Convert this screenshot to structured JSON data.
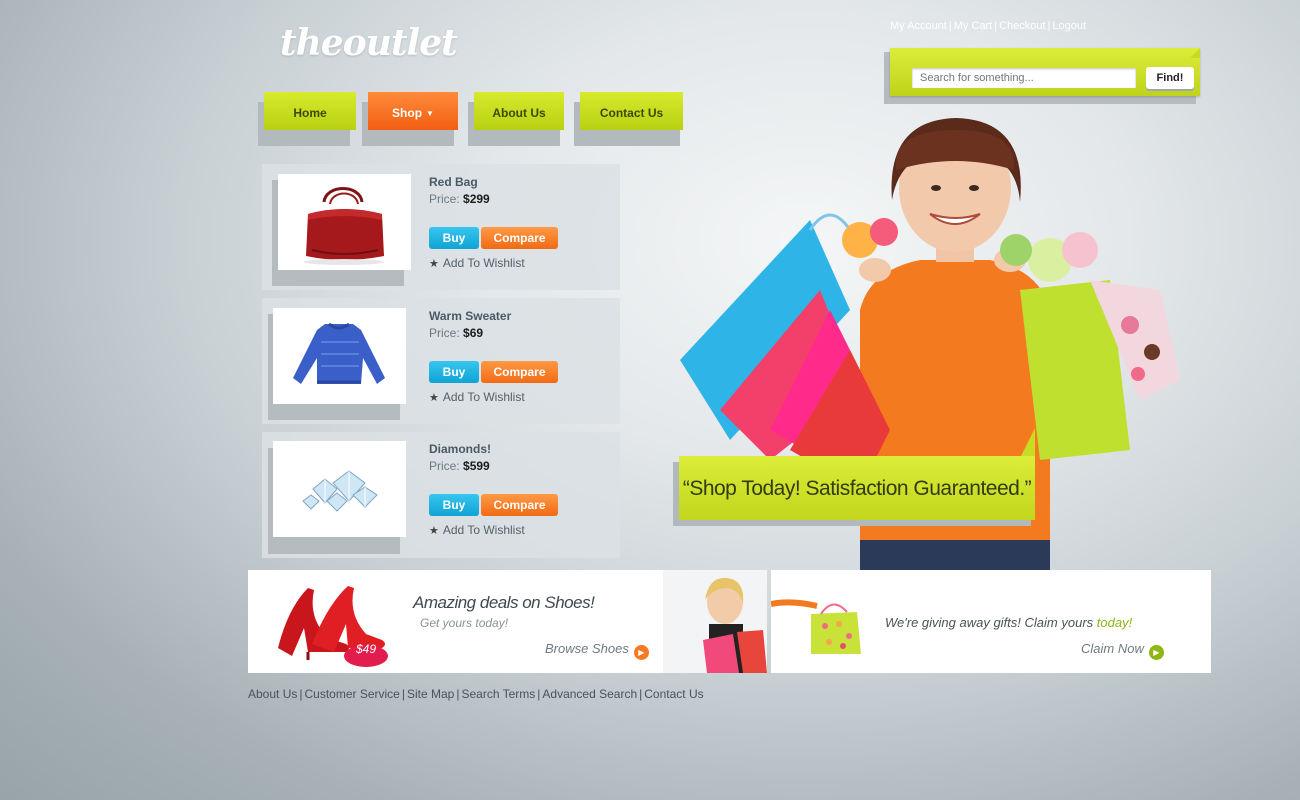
{
  "logo": "theoutlet",
  "top_links": [
    "My Account",
    "My Cart",
    "Checkout",
    "Logout"
  ],
  "search": {
    "placeholder": "Search for something...",
    "button": "Find!"
  },
  "nav": [
    {
      "label": "Home"
    },
    {
      "label": "Shop",
      "active": true
    },
    {
      "label": "About Us"
    },
    {
      "label": "Contact Us"
    }
  ],
  "products": [
    {
      "name": "Red Bag",
      "price_label": "Price:",
      "price": "$299",
      "buy": "Buy",
      "compare": "Compare",
      "wishlist": "Add To Wishlist"
    },
    {
      "name": "Warm Sweater",
      "price_label": "Price:",
      "price": "$69",
      "buy": "Buy",
      "compare": "Compare",
      "wishlist": "Add To Wishlist"
    },
    {
      "name": "Diamonds!",
      "price_label": "Price:",
      "price": "$599",
      "buy": "Buy",
      "compare": "Compare",
      "wishlist": "Add To Wishlist"
    }
  ],
  "hero": {
    "tagline": "“Shop Today! Satisfaction Guaranteed.”"
  },
  "promos": {
    "shoes": {
      "title": "Amazing deals on Shoes!",
      "subtitle": "Get yours today!",
      "link": "Browse Shoes",
      "price_tag": "$49"
    },
    "gifts": {
      "text": "We're giving away gifts! Claim yours",
      "highlight": "today!",
      "link": "Claim Now"
    }
  },
  "footer_links": [
    "About Us",
    "Customer Service",
    "Site Map",
    "Search Terms",
    "Advanced Search",
    "Contact Us"
  ],
  "colors": {
    "lime": "#c8dc22",
    "orange": "#f26a15",
    "blue": "#10a3d4"
  }
}
